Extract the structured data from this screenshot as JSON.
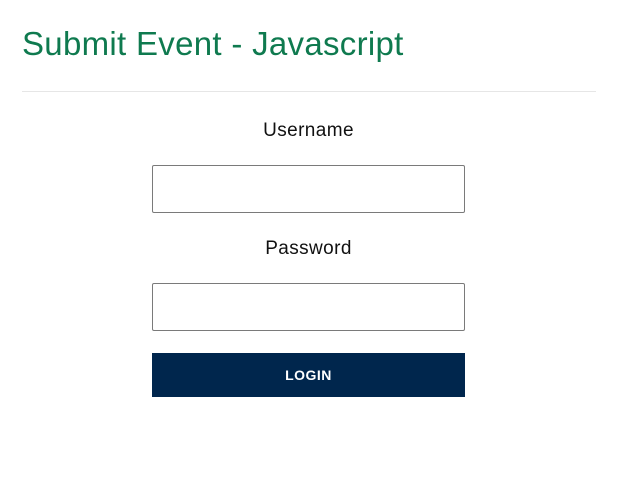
{
  "header": {
    "title": "Submit Event - Javascript"
  },
  "form": {
    "username_label": "Username",
    "username_value": "",
    "password_label": "Password",
    "password_value": "",
    "login_label": "LOGIN"
  },
  "colors": {
    "title": "#0f7a4f",
    "button_bg": "#00264d",
    "button_text": "#ffffff",
    "divider": "#e6e6e6"
  }
}
